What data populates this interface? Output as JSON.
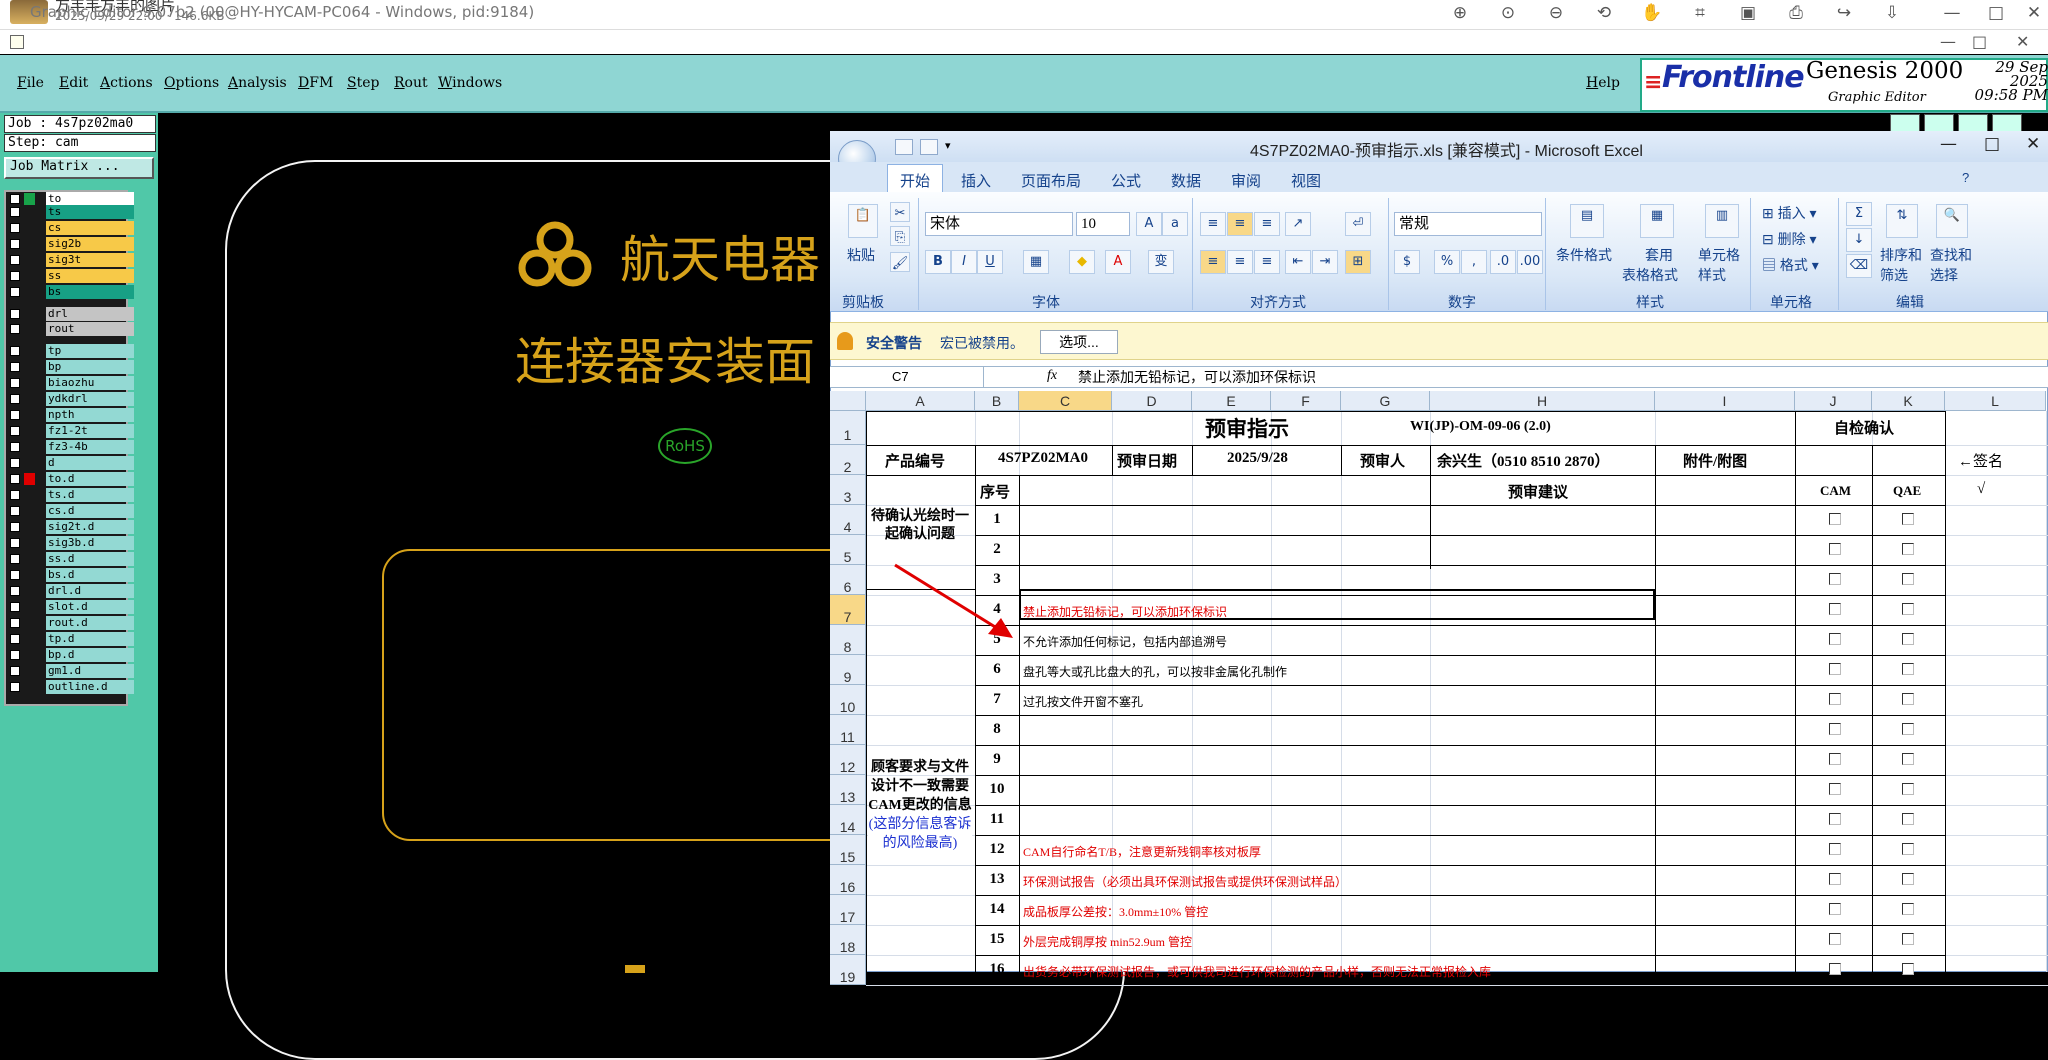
{
  "viewer": {
    "title": "方丰丰方丰的图片",
    "subtitle": "2025/09/29 22:00 · 146.6KB"
  },
  "graphic_editor": {
    "title": "Graphic Editor 9.07b2 (00@HY-HYCAM-PC064 - Windows, pid:9184)",
    "menu": [
      "File",
      "Edit",
      "Actions",
      "Options",
      "Analysis",
      "DFM",
      "Step",
      "Rout",
      "Windows"
    ],
    "help": "Help",
    "brand": {
      "logo": "Frontline",
      "product": "Genesis 2000",
      "sub": "Graphic Editor",
      "date": "29 Sep 2025",
      "time": "09:58 PM"
    },
    "job": "Job : 4s7pz02ma0",
    "step": "Step: cam",
    "job_matrix": "Job Matrix ...",
    "layers": [
      {
        "name": "to",
        "color": "#ffffff",
        "sw": "#18a34a"
      },
      {
        "name": "ts",
        "color": "#17a085",
        "sw": ""
      },
      {
        "name": "cs",
        "color": "#f7c948",
        "sw": ""
      },
      {
        "name": "sig2b",
        "color": "#f7c948",
        "sw": ""
      },
      {
        "name": "sig3t",
        "color": "#f7c948",
        "sw": ""
      },
      {
        "name": "ss",
        "color": "#f7c948",
        "sw": ""
      },
      {
        "name": "bs",
        "color": "#17a085",
        "sw": ""
      },
      {
        "name": "drl",
        "color": "#c4c4c4",
        "sw": ""
      },
      {
        "name": "rout",
        "color": "#c4c4c4",
        "sw": ""
      },
      {
        "name": "tp",
        "color": "#93d9d3",
        "sw": ""
      },
      {
        "name": "bp",
        "color": "#93d9d3",
        "sw": ""
      },
      {
        "name": "biaozhu",
        "color": "#93d9d3",
        "sw": ""
      },
      {
        "name": "ydkdrl",
        "color": "#93d9d3",
        "sw": ""
      },
      {
        "name": "npth",
        "color": "#93d9d3",
        "sw": ""
      },
      {
        "name": "fz1-2t",
        "color": "#93d9d3",
        "sw": ""
      },
      {
        "name": "fz3-4b",
        "color": "#93d9d3",
        "sw": ""
      },
      {
        "name": "d",
        "color": "#93d9d3",
        "sw": ""
      },
      {
        "name": "to.d",
        "color": "#93d9d3",
        "sw": "#e00000"
      },
      {
        "name": "ts.d",
        "color": "#93d9d3",
        "sw": ""
      },
      {
        "name": "cs.d",
        "color": "#93d9d3",
        "sw": ""
      },
      {
        "name": "sig2t.d",
        "color": "#93d9d3",
        "sw": ""
      },
      {
        "name": "sig3b.d",
        "color": "#93d9d3",
        "sw": ""
      },
      {
        "name": "ss.d",
        "color": "#93d9d3",
        "sw": ""
      },
      {
        "name": "bs.d",
        "color": "#93d9d3",
        "sw": ""
      },
      {
        "name": "drl.d",
        "color": "#93d9d3",
        "sw": ""
      },
      {
        "name": "slot.d",
        "color": "#93d9d3",
        "sw": ""
      },
      {
        "name": "rout.d",
        "color": "#93d9d3",
        "sw": ""
      },
      {
        "name": "tp.d",
        "color": "#93d9d3",
        "sw": ""
      },
      {
        "name": "bp.d",
        "color": "#93d9d3",
        "sw": ""
      },
      {
        "name": "gm1.d",
        "color": "#93d9d3",
        "sw": ""
      },
      {
        "name": "outline.d",
        "color": "#93d9d3",
        "sw": ""
      }
    ],
    "canvas": {
      "text1": "航天电器",
      "text2": "连接器安装面",
      "rohs": "RoHS"
    }
  },
  "excel": {
    "title": "4S7PZ02MA0-预审指示.xls [兼容模式] - Microsoft Excel",
    "tabs": [
      "开始",
      "插入",
      "页面布局",
      "公式",
      "数据",
      "审阅",
      "视图"
    ],
    "ribbon": {
      "paste": "粘贴",
      "font_name": "宋体",
      "font_size": "10",
      "number_format": "常规",
      "cond_fmt": "条件格式",
      "table_fmt1": "套用",
      "table_fmt2": "表格格式",
      "cell_style1": "单元格",
      "cell_style2": "样式",
      "insert": "插入",
      "delete": "删除",
      "format": "格式",
      "sort1": "排序和",
      "sort2": "筛选",
      "find1": "查找和",
      "find2": "选择",
      "groups": [
        "剪贴板",
        "字体",
        "对齐方式",
        "数字",
        "样式",
        "单元格",
        "编辑"
      ]
    },
    "security": {
      "label": "安全警告",
      "text": "宏已被禁用。",
      "button": "选项..."
    },
    "name_box": "C7",
    "fx": "fx",
    "formula": "禁止添加无铅标记，可以添加环保标识",
    "columns": [
      "A",
      "B",
      "C",
      "D",
      "E",
      "F",
      "G",
      "H",
      "I",
      "J",
      "K",
      "L"
    ],
    "rows": [
      "1",
      "2",
      "3",
      "4",
      "5",
      "6",
      "7",
      "8",
      "9",
      "10",
      "11",
      "12",
      "13",
      "14",
      "15",
      "16",
      "17",
      "18",
      "19"
    ],
    "header_title": "预审指示",
    "doc_no": "WI(JP)-OM-09-06 (2.0)",
    "self_check": "自检确认",
    "row2": {
      "product_no_label": "产品编号",
      "product_no": "4S7PZ02MA0",
      "date_label": "预审日期",
      "date": "2025/9/28",
      "reviewer_label": "预审人",
      "reviewer": "余兴生（0510 8510 2870）",
      "attach": "附件/附图",
      "sign": "←签名"
    },
    "row3": {
      "seq": "序号",
      "advice": "预审建议",
      "cam": "CAM",
      "qae": "QAE",
      "check": "√"
    },
    "section1": "待确认光绘时一起确认问题",
    "section2a": "顾客要求与文件设计不一致需要CAM更改的信息指示",
    "section2b": "(这部分信息客诉的风险最高)",
    "items": [
      {
        "n": "1",
        "text": ""
      },
      {
        "n": "2",
        "text": ""
      },
      {
        "n": "3",
        "text": ""
      },
      {
        "n": "4",
        "text": "禁止添加无铅标记，可以添加环保标识",
        "red": true
      },
      {
        "n": "5",
        "text": "不允许添加任何标记，包括内部追溯号",
        "red": false
      },
      {
        "n": "6",
        "text": "盘孔等大或孔比盘大的孔，可以按非金属化孔制作",
        "red": false
      },
      {
        "n": "7",
        "text": "过孔按文件开窗不塞孔",
        "red": false
      },
      {
        "n": "8",
        "text": ""
      },
      {
        "n": "9",
        "text": ""
      },
      {
        "n": "10",
        "text": ""
      },
      {
        "n": "11",
        "text": ""
      },
      {
        "n": "12",
        "text": "CAM自行命名T/B，注意更新残铜率核对板厚",
        "red": true
      },
      {
        "n": "13",
        "text": "环保测试报告（必须出具环保测试报告或提供环保测试样品）",
        "red": true
      },
      {
        "n": "14",
        "text": "成品板厚公差按：3.0mm±10% 管控",
        "red": true
      },
      {
        "n": "15",
        "text": "外层完成铜厚按 min52.9um 管控",
        "red": true
      },
      {
        "n": "16",
        "text": "出货务必带环保测试报告，或可供我司进行环保检测的产品小样，否则无法正常报检入库",
        "red": true
      }
    ]
  }
}
